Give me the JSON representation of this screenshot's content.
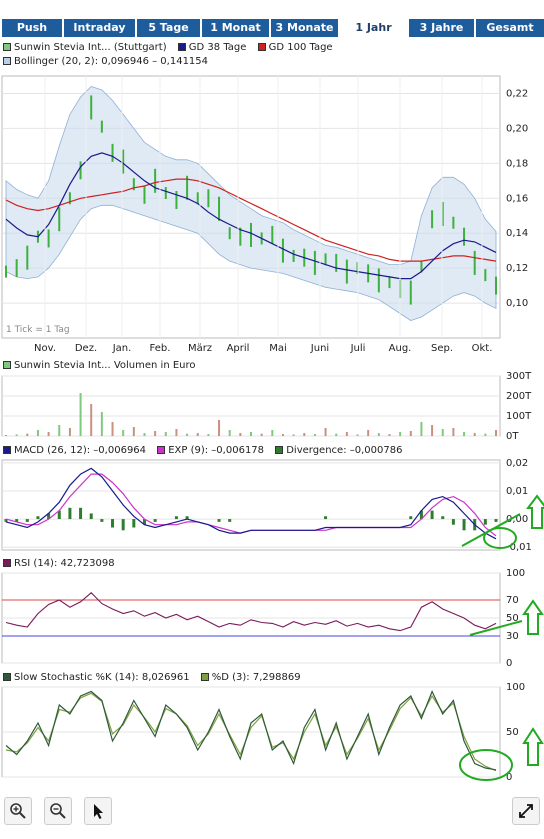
{
  "tabs": [
    {
      "label": "Push",
      "active": false
    },
    {
      "label": "Intraday",
      "active": false
    },
    {
      "label": "5 Tage",
      "active": false
    },
    {
      "label": "1 Monat",
      "active": false
    },
    {
      "label": "3 Monate",
      "active": false
    },
    {
      "label": "1 Jahr",
      "active": true
    },
    {
      "label": "3 Jahre",
      "active": false
    },
    {
      "label": "Gesamt",
      "active": false
    }
  ],
  "colors": {
    "tab_bg": "#1f5c9c",
    "price_green": "#3db03d",
    "sma38": "#1a1a8c",
    "sma100": "#cc2222",
    "band_fill": "#c9dcef",
    "macd": "#1a1a8c",
    "exp": "#cc33cc",
    "divergence": "#2e7d2e",
    "rsi": "#7a1a5a",
    "stoch_k": "#2e5a3a",
    "stoch_d": "#7fa040",
    "annotation": "#22aa22"
  },
  "chart_data": [
    {
      "type": "line",
      "legend": [
        {
          "label": "Sunwin Stevia Int... (Stuttgart)",
          "color": "#7fc97f"
        },
        {
          "label": "GD 38 Tage",
          "color": "#1a1a8c"
        },
        {
          "label": "GD 100 Tage",
          "color": "#cc2222"
        },
        {
          "label": "Bollinger (20, 2): 0,096946 – 0,141154",
          "color": "#b9cfe8"
        }
      ],
      "note": "1 Tick = 1 Tag",
      "x_ticks": [
        "Nov.",
        "Dez.",
        "Jan.",
        "Feb.",
        "März",
        "April",
        "Mai",
        "Juni",
        "Juli",
        "Aug.",
        "Sep.",
        "Okt."
      ],
      "y_ticks": [
        "0,22",
        "0,20",
        "0,18",
        "0,16",
        "0,14",
        "0,12",
        "0,10"
      ],
      "ylim": [
        0.08,
        0.23
      ],
      "series": [
        {
          "name": "Sunwin Stevia Int... (Stuttgart)",
          "values": [
            0.118,
            0.12,
            0.126,
            0.138,
            0.137,
            0.148,
            0.16,
            0.176,
            0.212,
            0.201,
            0.186,
            0.181,
            0.168,
            0.162,
            0.17,
            0.163,
            0.159,
            0.166,
            0.16,
            0.16,
            0.154,
            0.14,
            0.138,
            0.139,
            0.137,
            0.139,
            0.13,
            0.127,
            0.126,
            0.123,
            0.125,
            0.123,
            0.118,
            0.12,
            0.117,
            0.113,
            0.112,
            0.108,
            0.106,
            0.121,
            0.148,
            0.151,
            0.146,
            0.138,
            0.123,
            0.116,
            0.11
          ]
        },
        {
          "name": "GD 38 Tage",
          "values": [
            0.148,
            0.143,
            0.139,
            0.138,
            0.145,
            0.156,
            0.168,
            0.178,
            0.184,
            0.186,
            0.184,
            0.18,
            0.175,
            0.17,
            0.166,
            0.164,
            0.162,
            0.16,
            0.157,
            0.152,
            0.148,
            0.145,
            0.142,
            0.14,
            0.137,
            0.134,
            0.131,
            0.128,
            0.126,
            0.124,
            0.122,
            0.12,
            0.119,
            0.118,
            0.117,
            0.116,
            0.115,
            0.114,
            0.114,
            0.118,
            0.124,
            0.13,
            0.134,
            0.136,
            0.135,
            0.132,
            0.129
          ]
        },
        {
          "name": "GD 100 Tage",
          "values": [
            0.159,
            0.156,
            0.154,
            0.153,
            0.154,
            0.156,
            0.158,
            0.16,
            0.161,
            0.162,
            0.163,
            0.164,
            0.166,
            0.167,
            0.169,
            0.17,
            0.171,
            0.171,
            0.17,
            0.168,
            0.166,
            0.163,
            0.16,
            0.157,
            0.154,
            0.151,
            0.148,
            0.145,
            0.142,
            0.139,
            0.136,
            0.134,
            0.132,
            0.13,
            0.128,
            0.127,
            0.125,
            0.124,
            0.124,
            0.124,
            0.125,
            0.126,
            0.127,
            0.127,
            0.126,
            0.125,
            0.124
          ]
        },
        {
          "name": "Bollinger oben",
          "values": [
            0.17,
            0.165,
            0.162,
            0.16,
            0.17,
            0.19,
            0.208,
            0.218,
            0.224,
            0.222,
            0.216,
            0.208,
            0.2,
            0.192,
            0.188,
            0.184,
            0.182,
            0.182,
            0.18,
            0.174,
            0.168,
            0.162,
            0.158,
            0.154,
            0.15,
            0.148,
            0.146,
            0.142,
            0.139,
            0.136,
            0.133,
            0.132,
            0.13,
            0.128,
            0.126,
            0.124,
            0.122,
            0.122,
            0.124,
            0.15,
            0.166,
            0.172,
            0.172,
            0.168,
            0.16,
            0.148,
            0.141
          ]
        },
        {
          "name": "Bollinger unten",
          "values": [
            0.118,
            0.115,
            0.114,
            0.115,
            0.12,
            0.128,
            0.138,
            0.148,
            0.154,
            0.156,
            0.156,
            0.154,
            0.152,
            0.15,
            0.148,
            0.146,
            0.144,
            0.142,
            0.14,
            0.134,
            0.128,
            0.124,
            0.122,
            0.12,
            0.119,
            0.118,
            0.117,
            0.115,
            0.113,
            0.111,
            0.109,
            0.108,
            0.107,
            0.106,
            0.104,
            0.102,
            0.098,
            0.094,
            0.09,
            0.092,
            0.096,
            0.1,
            0.104,
            0.106,
            0.104,
            0.1,
            0.097
          ]
        }
      ]
    },
    {
      "type": "bar",
      "legend": [
        {
          "label": "Sunwin Stevia Int... Volumen in Euro",
          "color": "#7fc97f"
        }
      ],
      "y_ticks": [
        "300T",
        "200T",
        "100T",
        "0T"
      ],
      "ylim": [
        0,
        300
      ],
      "series": [
        {
          "name": "Sunwin Stevia Int... Volumen in Euro",
          "values": [
            5,
            8,
            12,
            30,
            20,
            55,
            40,
            215,
            160,
            120,
            70,
            30,
            45,
            15,
            25,
            20,
            35,
            12,
            15,
            10,
            80,
            30,
            15,
            20,
            12,
            30,
            10,
            8,
            15,
            10,
            40,
            12,
            20,
            8,
            30,
            15,
            10,
            20,
            25,
            70,
            55,
            35,
            40,
            20,
            15,
            12,
            30
          ]
        }
      ]
    },
    {
      "type": "line",
      "legend": [
        {
          "label": "MACD (26, 12): –0,006964",
          "color": "#1a1a8c"
        },
        {
          "label": "EXP (9): –0,006178",
          "color": "#cc33cc"
        },
        {
          "label": "Divergence: –0,000786",
          "color": "#2e7d2e"
        }
      ],
      "y_ticks": [
        "0,02",
        "0,01",
        "0,00",
        "-0,01"
      ],
      "ylim": [
        -0.011,
        0.021
      ],
      "series": [
        {
          "name": "MACD (26, 12)",
          "values": [
            -0.001,
            -0.002,
            -0.003,
            -0.001,
            0.002,
            0.006,
            0.012,
            0.016,
            0.018,
            0.015,
            0.01,
            0.005,
            0.001,
            -0.002,
            -0.003,
            -0.002,
            -0.001,
            0.0,
            -0.001,
            -0.002,
            -0.004,
            -0.005,
            -0.005,
            -0.004,
            -0.004,
            -0.004,
            -0.004,
            -0.004,
            -0.004,
            -0.004,
            -0.003,
            -0.003,
            -0.003,
            -0.003,
            -0.003,
            -0.003,
            -0.003,
            -0.003,
            -0.002,
            0.003,
            0.007,
            0.008,
            0.006,
            0.002,
            -0.002,
            -0.005,
            -0.007
          ]
        },
        {
          "name": "EXP (9)",
          "values": [
            0.0,
            -0.001,
            -0.002,
            -0.002,
            0.0,
            0.003,
            0.008,
            0.012,
            0.016,
            0.016,
            0.013,
            0.009,
            0.004,
            0.0,
            -0.002,
            -0.002,
            -0.002,
            -0.001,
            -0.001,
            -0.002,
            -0.003,
            -0.004,
            -0.005,
            -0.004,
            -0.004,
            -0.004,
            -0.004,
            -0.004,
            -0.004,
            -0.004,
            -0.004,
            -0.003,
            -0.003,
            -0.003,
            -0.003,
            -0.003,
            -0.003,
            -0.003,
            -0.003,
            0.0,
            0.004,
            0.007,
            0.008,
            0.006,
            0.002,
            -0.003,
            -0.006
          ]
        },
        {
          "name": "Divergence",
          "values": [
            -0.001,
            -0.001,
            -0.001,
            0.001,
            0.002,
            0.003,
            0.004,
            0.004,
            0.002,
            -0.001,
            -0.003,
            -0.004,
            -0.003,
            -0.002,
            -0.001,
            0.0,
            0.001,
            0.001,
            0.0,
            0.0,
            -0.001,
            -0.001,
            0.0,
            0.0,
            0.0,
            0.0,
            0.0,
            0.0,
            0.0,
            0.0,
            0.001,
            0.0,
            0.0,
            0.0,
            0.0,
            0.0,
            0.0,
            0.0,
            0.001,
            0.003,
            0.003,
            0.001,
            -0.002,
            -0.004,
            -0.004,
            -0.002,
            -0.001
          ]
        }
      ]
    },
    {
      "type": "line",
      "legend": [
        {
          "label": "RSI (14): 42,723098",
          "color": "#7a1a5a"
        }
      ],
      "y_ticks": [
        "100",
        "70",
        "50",
        "30",
        "0"
      ],
      "ylim": [
        0,
        100
      ],
      "reference_lines": [
        70,
        30
      ],
      "series": [
        {
          "name": "RSI (14)",
          "values": [
            45,
            42,
            40,
            55,
            65,
            70,
            62,
            68,
            78,
            66,
            60,
            55,
            58,
            52,
            56,
            50,
            54,
            48,
            52,
            46,
            40,
            44,
            42,
            48,
            45,
            44,
            40,
            46,
            42,
            45,
            43,
            47,
            41,
            44,
            40,
            42,
            38,
            36,
            40,
            62,
            68,
            60,
            55,
            50,
            42,
            38,
            44
          ]
        }
      ]
    },
    {
      "type": "line",
      "legend": [
        {
          "label": "Slow Stochastic %K (14): 8,026961",
          "color": "#2e5a3a"
        },
        {
          "label": "%D (3): 7,298869",
          "color": "#7fa040"
        }
      ],
      "y_ticks": [
        "100",
        "50",
        "0"
      ],
      "ylim": [
        0,
        100
      ],
      "series": [
        {
          "name": "Slow Stochastic %K (14)",
          "values": [
            35,
            25,
            40,
            60,
            35,
            80,
            70,
            90,
            95,
            85,
            40,
            60,
            85,
            65,
            45,
            80,
            70,
            55,
            30,
            50,
            75,
            45,
            20,
            60,
            70,
            30,
            40,
            15,
            55,
            75,
            30,
            60,
            20,
            45,
            70,
            25,
            55,
            80,
            90,
            65,
            95,
            70,
            85,
            40,
            15,
            10,
            8
          ]
        },
        {
          "name": "%D (3)",
          "values": [
            30,
            28,
            38,
            55,
            40,
            75,
            72,
            88,
            93,
            84,
            48,
            58,
            80,
            66,
            50,
            76,
            70,
            57,
            35,
            48,
            70,
            47,
            25,
            55,
            68,
            33,
            38,
            20,
            50,
            70,
            35,
            56,
            25,
            43,
            65,
            30,
            52,
            76,
            88,
            68,
            90,
            72,
            82,
            45,
            20,
            12,
            7
          ]
        }
      ]
    }
  ],
  "toolbar": {
    "zoom_in": "zoom-in-icon",
    "zoom_out": "zoom-out-icon",
    "pointer": "pointer-icon",
    "expand": "expand-icon"
  }
}
